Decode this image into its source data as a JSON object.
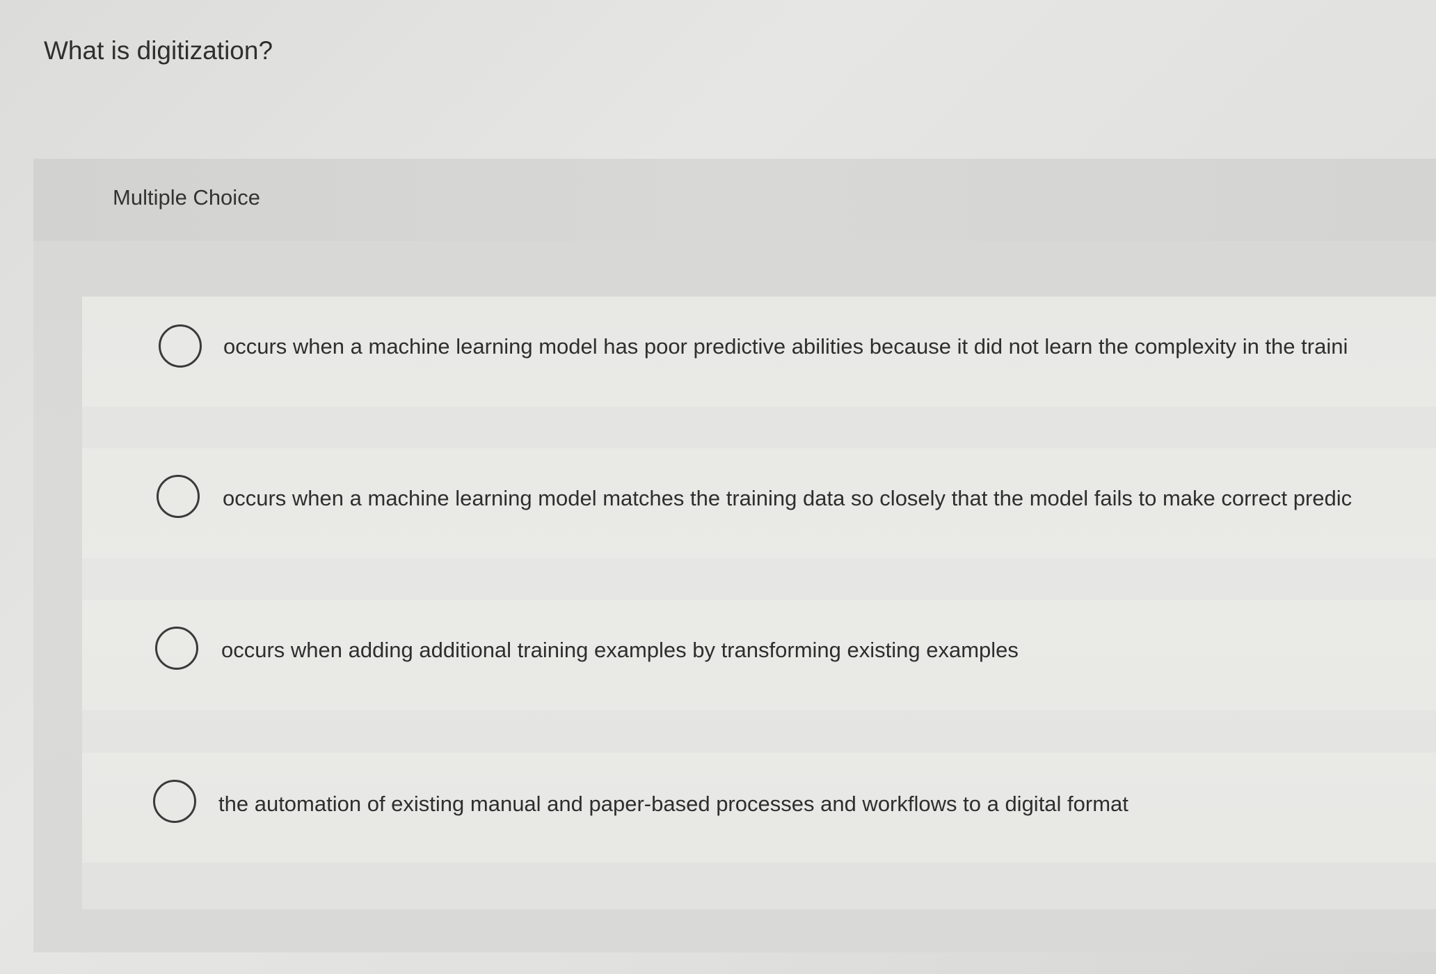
{
  "question": {
    "title": "What is digitization?",
    "type_label": "Multiple Choice"
  },
  "choices": [
    {
      "text": "occurs when a machine learning model has poor predictive abilities because it did not learn the complexity in the traini",
      "selected": false
    },
    {
      "text": "occurs when a machine learning model matches the training data so closely that the model fails to make correct predic",
      "selected": false
    },
    {
      "text": "occurs when adding additional training examples by transforming existing examples",
      "selected": false
    },
    {
      "text": "the automation of existing manual and paper-based processes and workflows to a digital format",
      "selected": false
    }
  ]
}
